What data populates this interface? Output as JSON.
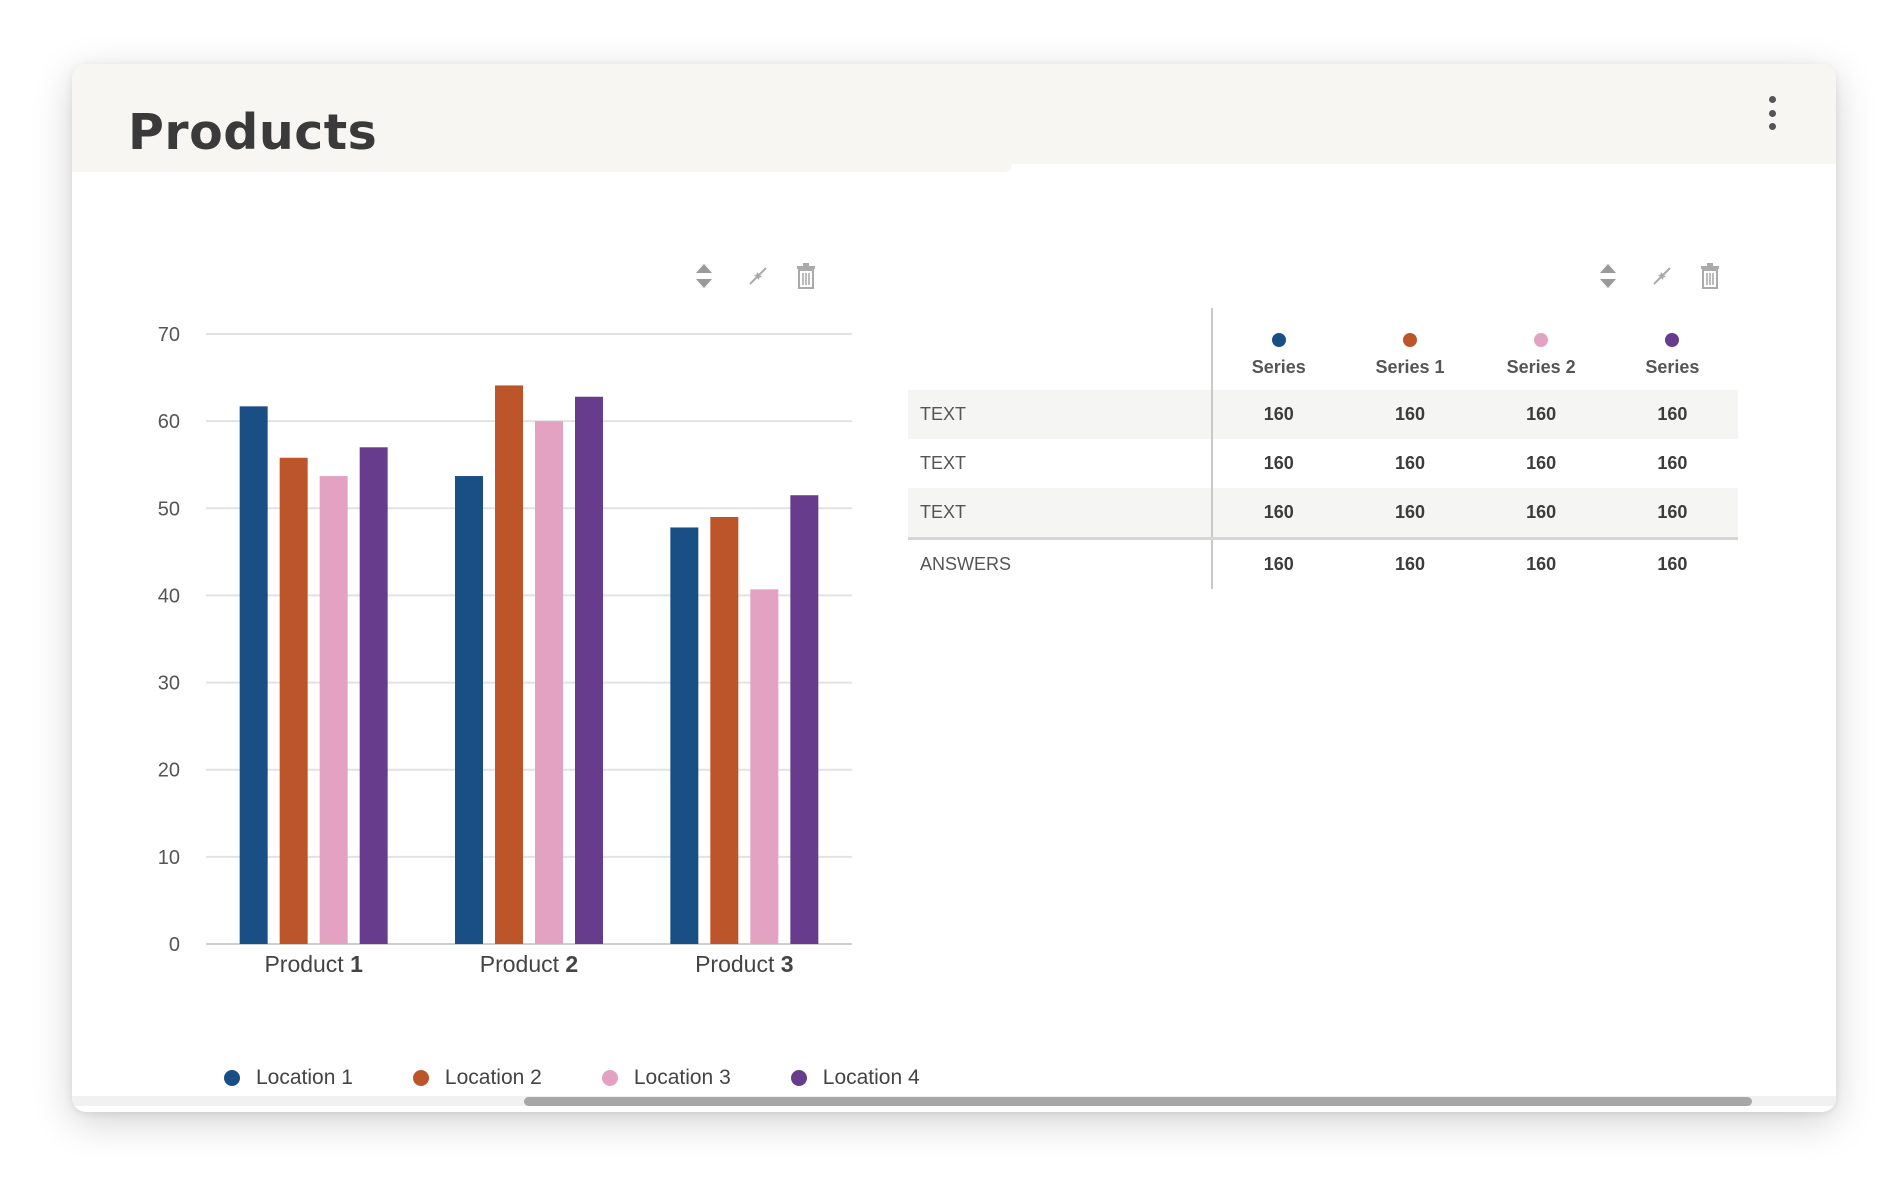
{
  "header": {
    "title": "Products"
  },
  "chart_data": {
    "type": "bar",
    "categories": [
      "Product 1",
      "Product 2",
      "Product 3"
    ],
    "category_labels": [
      {
        "prefix": "Product",
        "number": "1"
      },
      {
        "prefix": "Product",
        "number": "2"
      },
      {
        "prefix": "Product",
        "number": "3"
      }
    ],
    "series": [
      {
        "name": "Location 1",
        "color": "#1a4f86",
        "values": [
          61.7,
          53.7,
          47.8
        ]
      },
      {
        "name": "Location 2",
        "color": "#bd552a",
        "values": [
          55.8,
          64.1,
          49.0
        ]
      },
      {
        "name": "Location 3",
        "color": "#e3a2c2",
        "values": [
          53.7,
          60.0,
          40.7
        ]
      },
      {
        "name": "Location 4",
        "color": "#673c8d",
        "values": [
          57.0,
          62.8,
          51.5
        ]
      }
    ],
    "ylim": [
      0,
      70
    ],
    "yticks": [
      "0",
      "10",
      "20",
      "30",
      "40",
      "50",
      "60",
      "70"
    ],
    "grid": true,
    "legend": "bottom"
  },
  "table": {
    "columns": [
      {
        "name": "Series",
        "color": "#1a4f86"
      },
      {
        "name": "Series 1",
        "color": "#bd552a"
      },
      {
        "name": "Series 2",
        "color": "#e3a2c2"
      },
      {
        "name": "Series",
        "color": "#673c8d"
      }
    ],
    "rows": [
      {
        "label": "TEXT",
        "values": [
          "160",
          "160",
          "160",
          "160"
        ]
      },
      {
        "label": "TEXT",
        "values": [
          "160",
          "160",
          "160",
          "160"
        ]
      },
      {
        "label": "TEXT",
        "values": [
          "160",
          "160",
          "160",
          "160"
        ]
      },
      {
        "label": "ANSWERS",
        "values": [
          "160",
          "160",
          "160",
          "160"
        ]
      }
    ]
  },
  "icons": {
    "menu": "more-vertical-icon",
    "sort": "sort-icon",
    "collapse": "collapse-icon",
    "delete": "trash-icon"
  }
}
